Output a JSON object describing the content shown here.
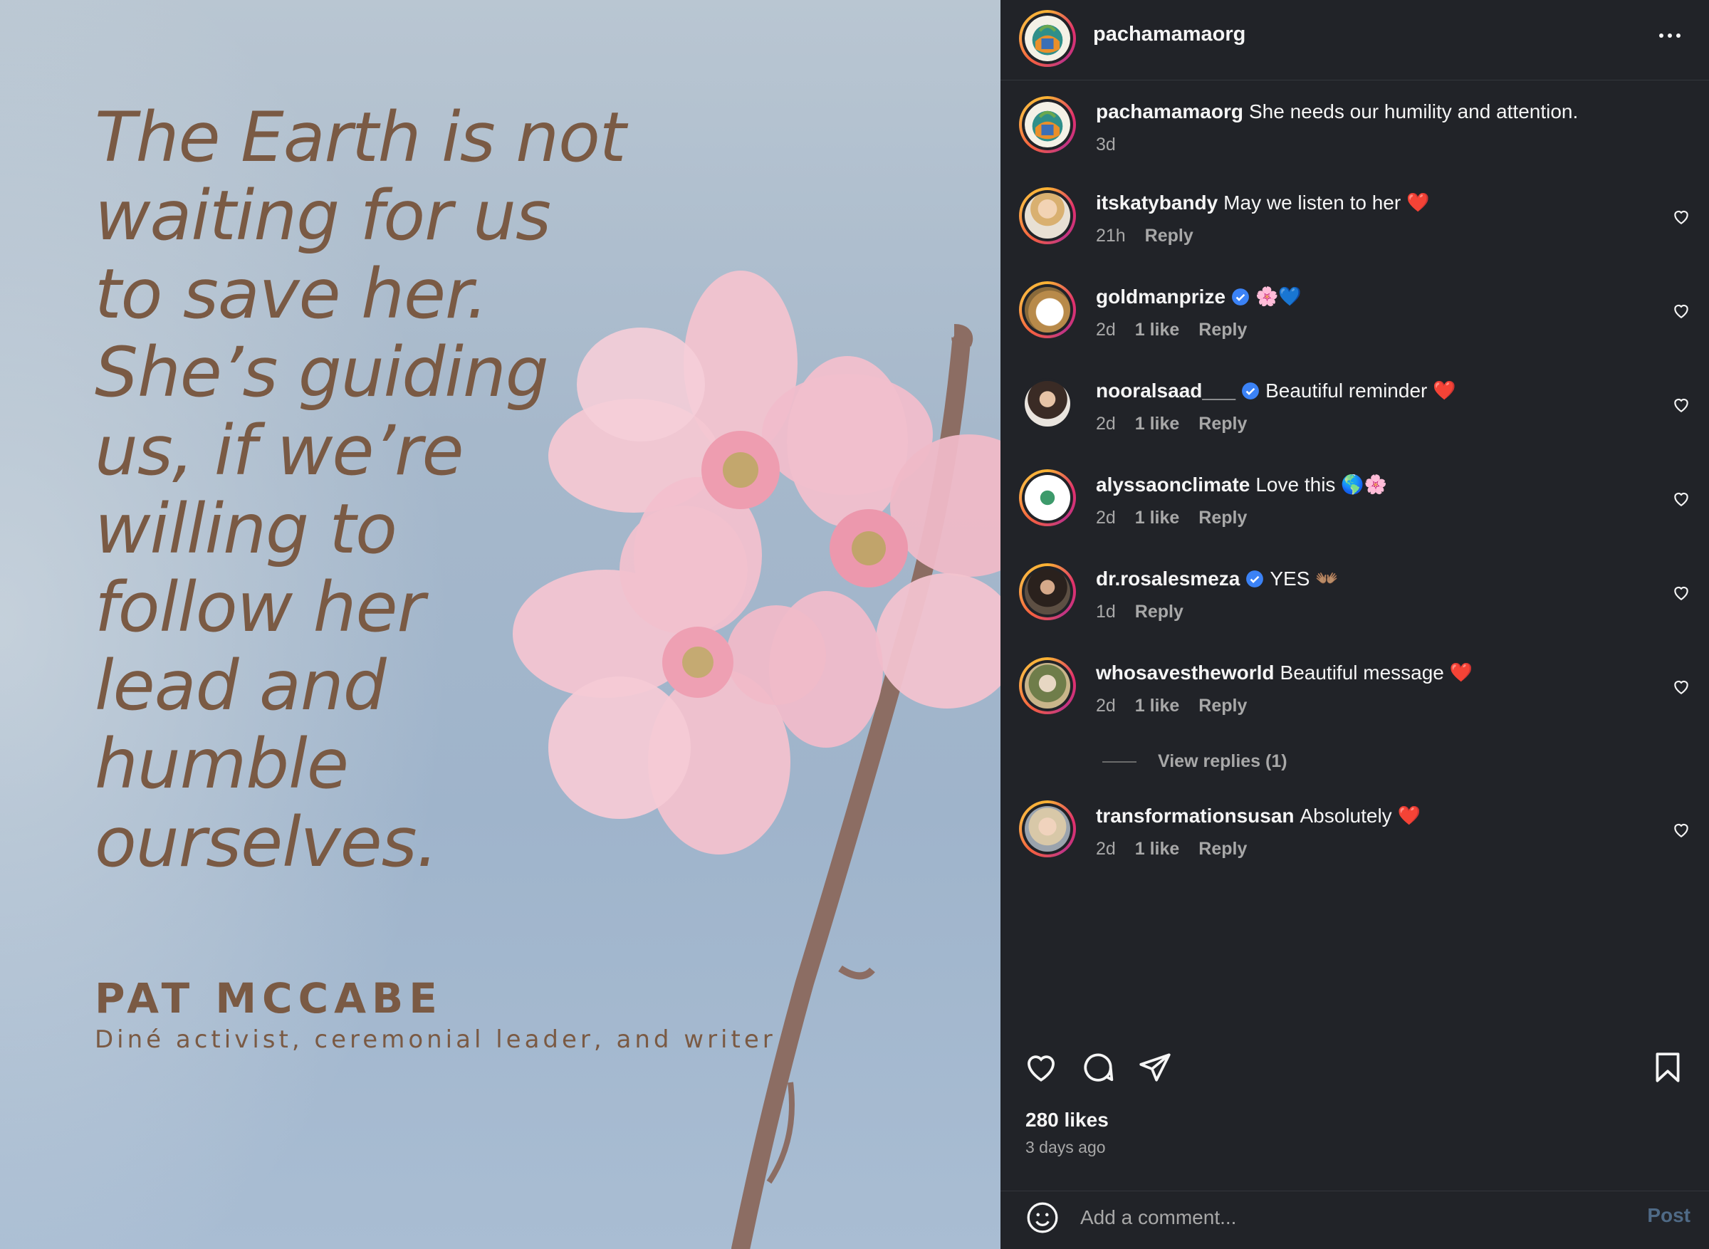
{
  "post": {
    "quote_lines": [
      "The Earth is not",
      "waiting for us",
      "to save her.",
      "She’s guiding",
      "us, if we’re",
      "willing to",
      "follow her",
      "lead and",
      "humble",
      "ourselves."
    ],
    "author": "PAT MCCABE",
    "author_description": "Diné activist, ceremonial leader, and writer"
  },
  "header": {
    "username": "pachamamaorg"
  },
  "caption": {
    "username": "pachamamaorg",
    "text": "She needs our humility and attention.",
    "time": "3d"
  },
  "comments": [
    {
      "username": "itskatybandy",
      "verified": false,
      "text": "May we listen to her",
      "emoji": "❤️",
      "time": "21h",
      "likes": "",
      "reply": "Reply"
    },
    {
      "username": "goldmanprize",
      "verified": true,
      "text": "",
      "emoji": "🌸💙",
      "time": "2d",
      "likes": "1 like",
      "reply": "Reply"
    },
    {
      "username": "nooralsaad___",
      "verified": true,
      "text": "Beautiful reminder",
      "emoji": "❤️",
      "time": "2d",
      "likes": "1 like",
      "reply": "Reply"
    },
    {
      "username": "alyssaonclimate",
      "verified": false,
      "text": "Love this",
      "emoji": "🌎🌸",
      "time": "2d",
      "likes": "1 like",
      "reply": "Reply"
    },
    {
      "username": "dr.rosalesmeza",
      "verified": true,
      "text": "YES",
      "emoji": "👐🏽",
      "time": "1d",
      "likes": "",
      "reply": "Reply"
    },
    {
      "username": "whosavestheworld",
      "verified": false,
      "text": "Beautiful message",
      "emoji": "❤️",
      "time": "2d",
      "likes": "1 like",
      "reply": "Reply"
    },
    {
      "username": "transformationsusan",
      "verified": false,
      "text": "Absolutely",
      "emoji": "❤️",
      "time": "2d",
      "likes": "1 like",
      "reply": "Reply"
    }
  ],
  "view_replies": "View replies (1)",
  "likes_count": "280 likes",
  "post_time": "3 days ago",
  "comment_input": {
    "placeholder": "Add a comment..."
  },
  "post_button": "Post",
  "icons": {
    "like": "heart-icon",
    "comment": "speech-bubble-icon",
    "share": "paper-plane-icon",
    "save": "bookmark-icon",
    "emoji": "smiley-icon",
    "more": "ellipsis-icon"
  },
  "colors": {
    "panel_bg": "#212328",
    "text_primary": "#f5f5f5",
    "text_secondary": "#a8a8a8",
    "quote_text": "#7a5a44",
    "verified_blue": "#3b82f6",
    "post_button_disabled": "#4f6a86"
  }
}
